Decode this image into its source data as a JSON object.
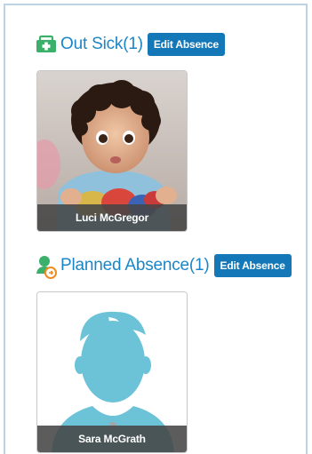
{
  "out_sick": {
    "title": "Out Sick(1)",
    "edit_label": "Edit Absence",
    "children": [
      {
        "name": "Luci McGregor",
        "photo": "child-photo"
      }
    ]
  },
  "planned_absence": {
    "title": "Planned Absence(1)",
    "edit_label": "Edit Absence",
    "children": [
      {
        "name": "Sara McGrath",
        "photo": "default-avatar"
      }
    ]
  },
  "colors": {
    "title": "#1b86c6",
    "button": "#1478b8",
    "sick_icon": "#3ab06a",
    "avatar": "#6cc3d8"
  },
  "icons": {
    "out_sick": "medical-kit-icon",
    "planned_absence": "person-calendar-icon"
  }
}
